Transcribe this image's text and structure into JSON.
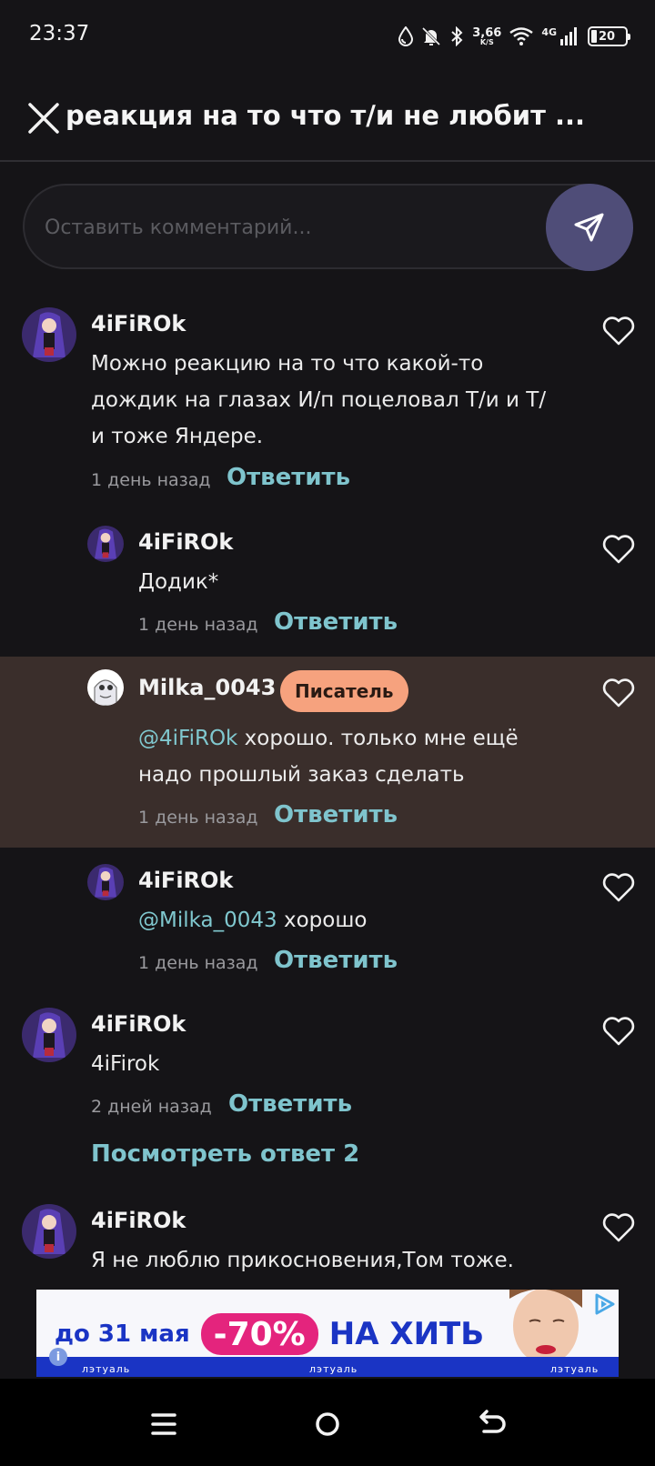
{
  "status_bar": {
    "time": "23:37",
    "net_speed_value": "3,66",
    "net_speed_unit": "K/S",
    "network": "4G",
    "battery_percent": "20",
    "icons": [
      "drop-icon",
      "bell-off-icon",
      "bluetooth-icon",
      "wifi-icon",
      "signal-icon",
      "battery-icon"
    ]
  },
  "header": {
    "title": "реакция на то что т/и не любит ...",
    "close_icon": "close-icon"
  },
  "comment_box": {
    "placeholder": "Оставить комментарий...",
    "send_icon": "send-icon"
  },
  "comments": [
    {
      "username": "4iFiROk",
      "text_lines": [
        "Можно реакцию на то что какой-то",
        "дождик на глазах И/п поцеловал Т/и и Т/",
        "и тоже Яндере."
      ],
      "time": "1 день назад",
      "reply_label": "Ответить"
    },
    {
      "username": "4iFiROk",
      "text": "Додик*",
      "time": "1 день назад",
      "reply_label": "Ответить"
    },
    {
      "username": "Milka_0043",
      "badge": "Писатель",
      "mention": "@4iFiROk",
      "text_line1": " хорошо. только мне ещё",
      "text_line2": "надо прошлый заказ сделать",
      "time": "1 день назад",
      "reply_label": "Ответить"
    },
    {
      "username": "4iFiROk",
      "mention": "@Milka_0043",
      "text": " хорошо",
      "time": "1 день назад",
      "reply_label": "Ответить"
    },
    {
      "username": "4iFiROk",
      "text": "4iFirok",
      "time": "2 дней назад",
      "reply_label": "Ответить",
      "view_replies": "Посмотреть ответ 2"
    },
    {
      "username": "4iFiROk",
      "text": "Я не люблю прикосновения,Том тоже."
    }
  ],
  "ad": {
    "date": "до 31 мая",
    "discount": "-70%",
    "headline": "НА ХИТЫ",
    "brand": "лэтуаль",
    "info": "i"
  },
  "colors": {
    "background": "#151417",
    "accent": "#7fc4cd",
    "badge": "#f6a27e",
    "highlight_row": "#3a2e2b",
    "send_button": "#4f4d78"
  }
}
